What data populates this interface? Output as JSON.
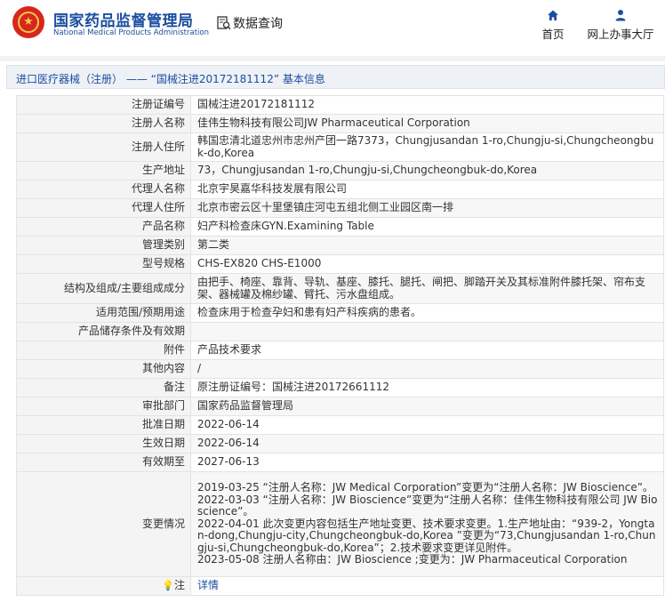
{
  "header": {
    "site_name_cn": "国家药品监督管理局",
    "site_name_en": "National Medical Products Administration",
    "search_label": "数据查询",
    "nav_home": "首页",
    "nav_hall": "网上办事大厅",
    "brand_color": "#1b4ea0",
    "logo_color": "#d7261e"
  },
  "title": "进口医疗器械（注册） —— “国械注进20172181112” 基本信息",
  "rows": [
    {
      "label": "注册证编号",
      "value": "国械注进20172181112"
    },
    {
      "label": "注册人名称",
      "value": "佳伟生物科技有限公司JW Pharmaceutical Corporation"
    },
    {
      "label": "注册人住所",
      "value": "韩国忠清北道忠州市忠州产团一路7373，Chungjusandan 1-ro,Chungju-si,Chungcheongbuk-do,Korea"
    },
    {
      "label": "生产地址",
      "value": "73，Chungjusandan 1-ro,Chungju-si,Chungcheongbuk-do,Korea"
    },
    {
      "label": "代理人名称",
      "value": "北京宇昊嘉华科技发展有限公司"
    },
    {
      "label": "代理人住所",
      "value": "北京市密云区十里堡镇庄河屯五组北侧工业园区南一排"
    },
    {
      "label": "产品名称",
      "value": "妇产科检查床GYN.Examining Table"
    },
    {
      "label": "管理类别",
      "value": "第二类"
    },
    {
      "label": "型号规格",
      "value": "CHS-EX820 CHS-E1000"
    },
    {
      "label": "结构及组成/主要组成成分",
      "value": "由把手、椅座、靠背、导轨、基座、膝托、腿托、闸把、脚踏开关及其标准附件膝托架、帘布支架、器械罐及棉纱罐、臂托、污水盘组成。"
    },
    {
      "label": "适用范围/预期用途",
      "value": "检查床用于检查孕妇和患有妇产科疾病的患者。"
    },
    {
      "label": "产品储存条件及有效期",
      "value": ""
    },
    {
      "label": "附件",
      "value": "产品技术要求"
    },
    {
      "label": "其他内容",
      "value": "/"
    },
    {
      "label": "备注",
      "value": "原注册证编号：国械注进20172661112"
    },
    {
      "label": "审批部门",
      "value": "国家药品监督管理局"
    },
    {
      "label": "批准日期",
      "value": "2022-06-14"
    },
    {
      "label": "生效日期",
      "value": "2022-06-14"
    },
    {
      "label": "有效期至",
      "value": "2027-06-13"
    },
    {
      "label": "变更情况",
      "value": "2019-03-25 “注册人名称：JW Medical Corporation”变更为“注册人名称：JW Bioscience”。\n2022-03-03 “注册人名称：JW Bioscience”变更为“注册人名称：佳伟生物科技有限公司 JW Bioscience”。\n2022-04-01 此次变更内容包括生产地址变更、技术要求变更。1.生产地址由：“939-2，Yongtan-dong,Chungju-city,Chungcheongbuk-do,Korea ”变更为“73,Chungjusandan 1-ro,Chungju-si,Chungcheongbuk-do,Korea”；2.技术要求变更详见附件。\n2023-05-08 注册人名称由：JW Bioscience ;变更为：JW Pharmaceutical Corporation"
    }
  ],
  "note": {
    "label": "注",
    "link": "详情"
  }
}
